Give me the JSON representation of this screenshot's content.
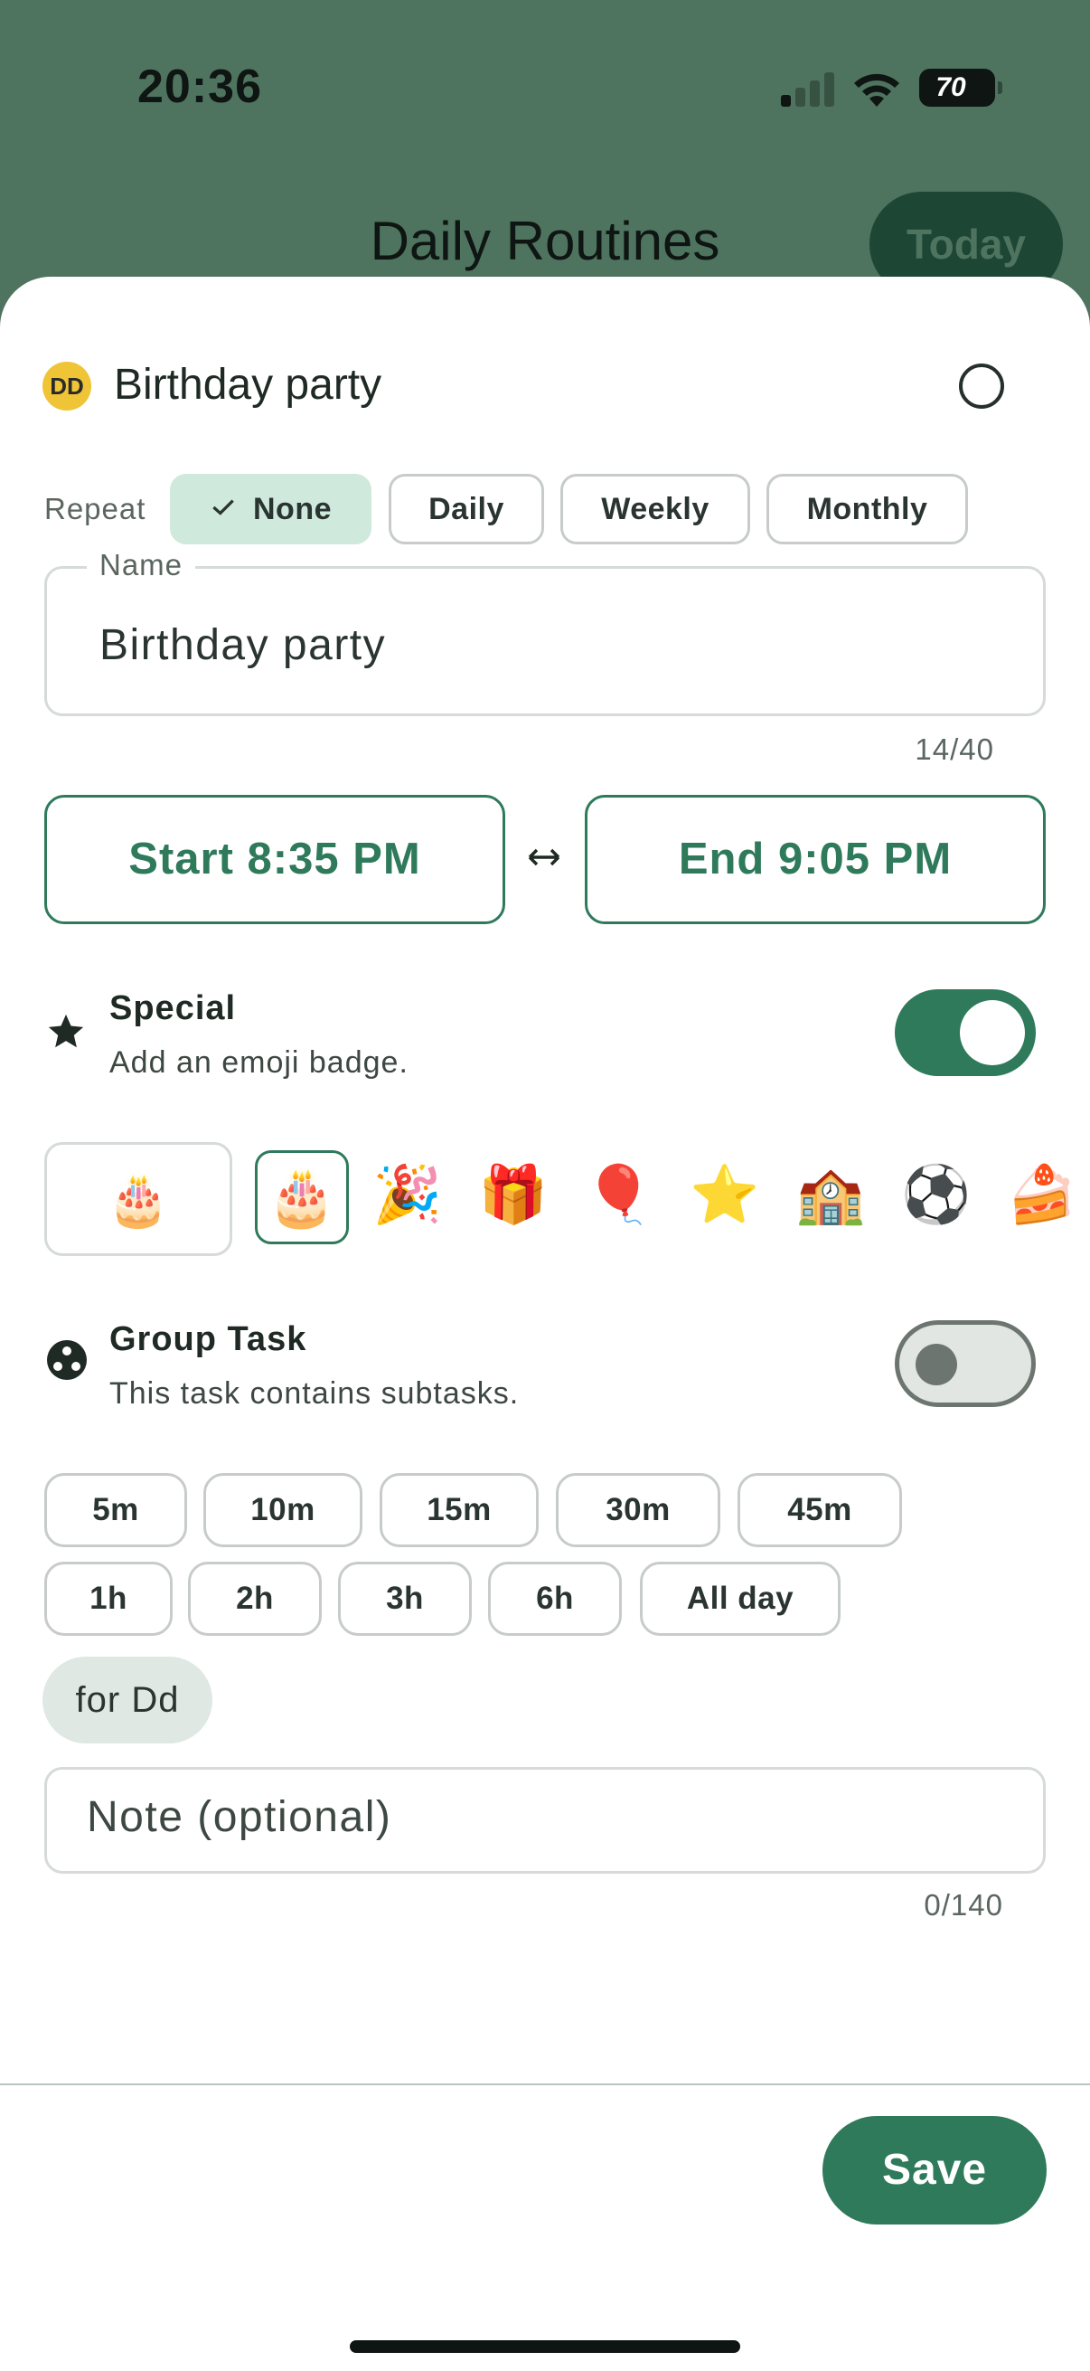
{
  "status_bar": {
    "time": "20:36",
    "battery": "70"
  },
  "app": {
    "title": "Daily Routines",
    "today_label": "Today"
  },
  "task": {
    "avatar_initials": "DD",
    "title": "Birthday party",
    "repeat_label": "Repeat",
    "repeat_options": [
      "None",
      "Daily",
      "Weekly",
      "Monthly"
    ],
    "repeat_selected": "None",
    "name_label": "Name",
    "name_value": "Birthday party",
    "name_counter": "14/40",
    "start_label": "Start 8:35 PM",
    "end_label": "End 9:05 PM",
    "special": {
      "title": "Special",
      "subtitle": "Add an emoji badge.",
      "enabled": true
    },
    "emoji_preview": "🎂",
    "emojis": [
      "🎂",
      "🎉",
      "🎁",
      "🎈",
      "⭐",
      "🏫",
      "⚽",
      "🍰"
    ],
    "emoji_selected": "🎂",
    "group_task": {
      "title": "Group Task",
      "subtitle": "This task contains subtasks.",
      "enabled": false
    },
    "durations_row1": [
      "5m",
      "10m",
      "15m",
      "30m",
      "45m"
    ],
    "durations_row2": [
      "1h",
      "2h",
      "3h",
      "6h",
      "All day"
    ],
    "assignee_chip": "for Dd",
    "note_placeholder": "Note (optional)",
    "note_counter": "0/140"
  },
  "footer": {
    "save_label": "Save"
  },
  "colors": {
    "accent": "#2e7a5b",
    "header_bg": "#4e735f",
    "selected_chip": "#cfe9dc",
    "avatar": "#f0c437"
  }
}
